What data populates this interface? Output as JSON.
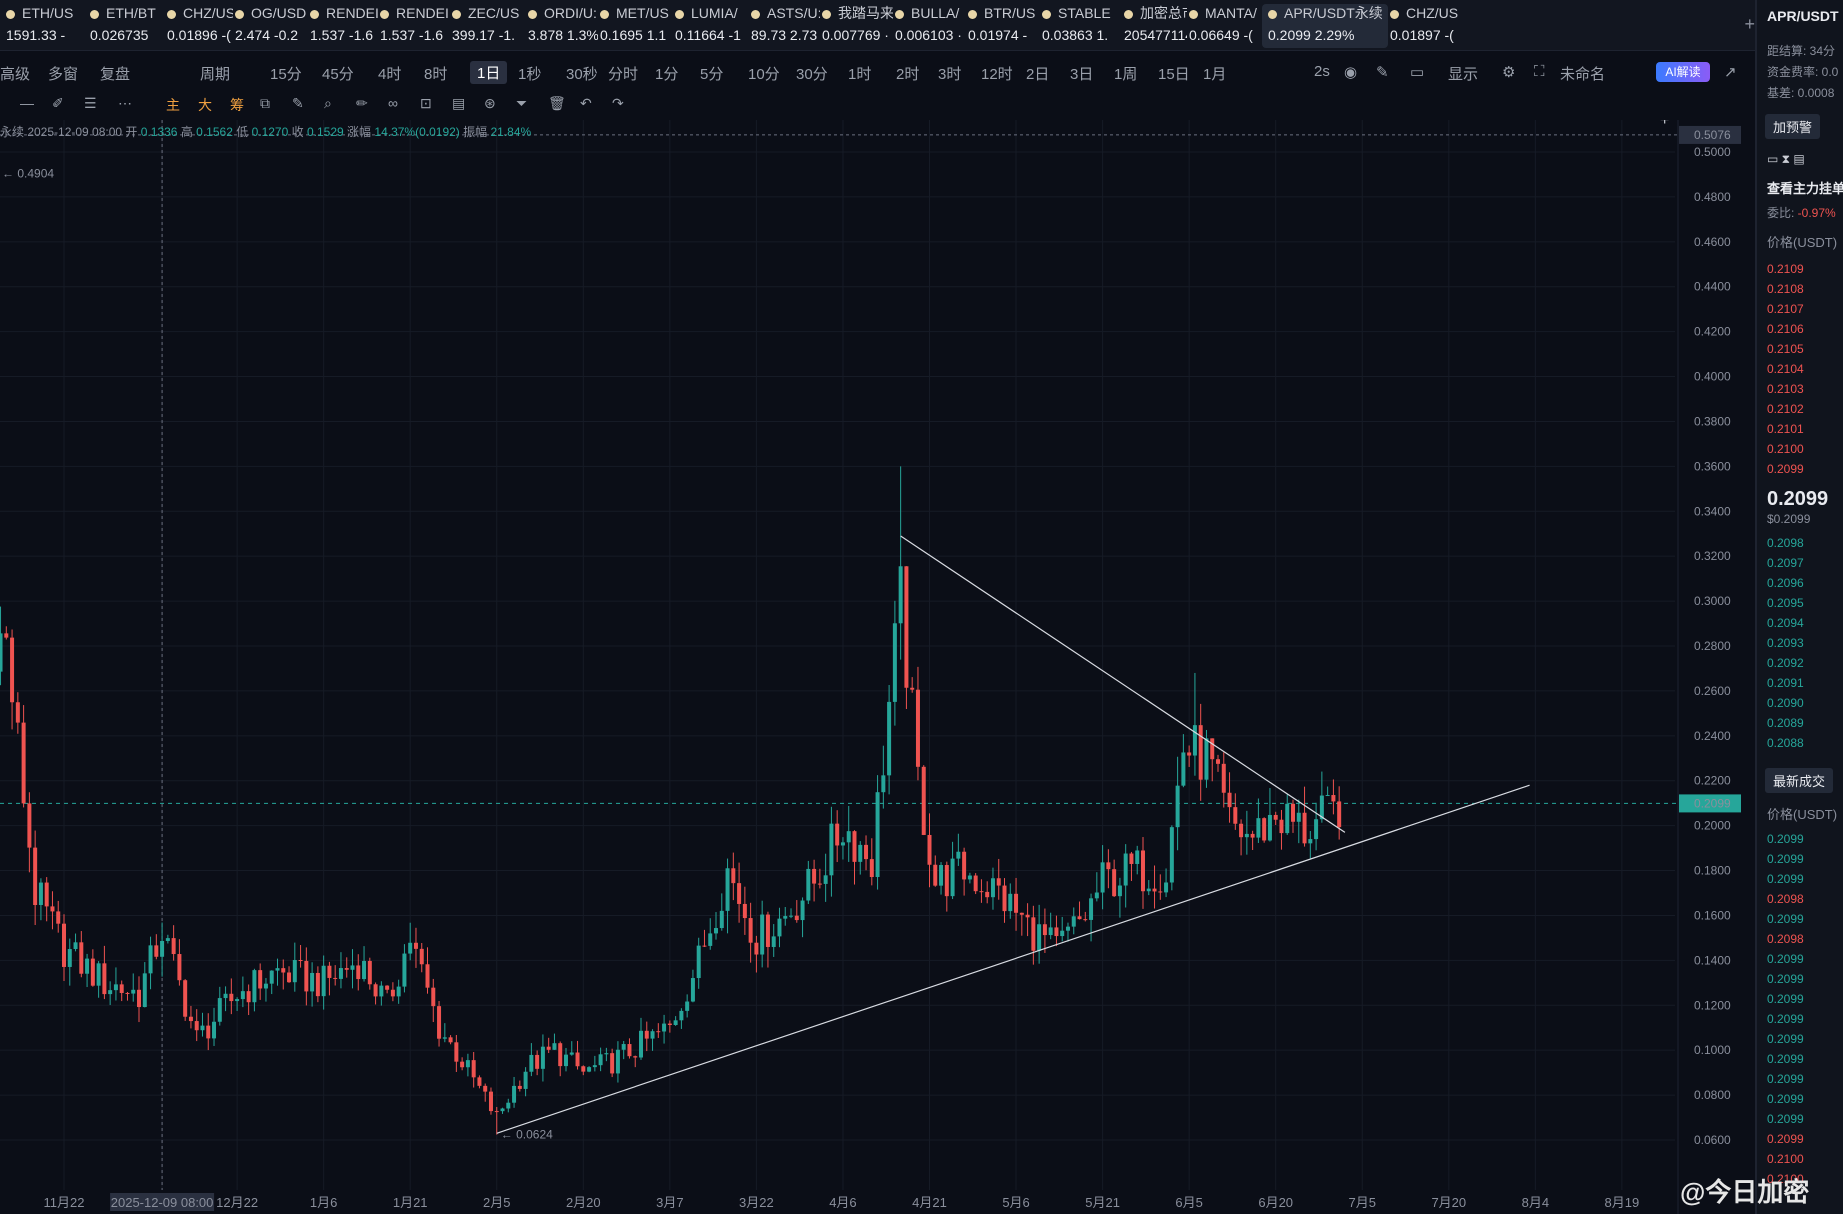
{
  "tickers": [
    {
      "sym": "ETH/US",
      "val": "1591.33 -",
      "dir": "up"
    },
    {
      "sym": "ETH/BT",
      "val": "0.026735",
      "dir": "dn"
    },
    {
      "sym": "CHZ/US",
      "val": "0.01896 -(",
      "dir": "neutral"
    },
    {
      "sym": "OG/USD",
      "val": "2.474 -0.2",
      "dir": "neutral"
    },
    {
      "sym": "RENDEI",
      "val": "1.537 -1.6",
      "dir": "up"
    },
    {
      "sym": "RENDEI",
      "val": "1.537 -1.6",
      "dir": "neutral"
    },
    {
      "sym": "ZEC/US",
      "val": "399.17 -1.",
      "dir": "neutral"
    },
    {
      "sym": "ORDI/U:",
      "val": "3.878 1.3%",
      "dir": "neutral"
    },
    {
      "sym": "MET/US",
      "val": "0.1695 1.1",
      "dir": "up"
    },
    {
      "sym": "LUMIA/",
      "val": "0.11664 -1",
      "dir": "neutral"
    },
    {
      "sym": "ASTS/U:",
      "val": "89.73 2.73",
      "dir": "neutral"
    },
    {
      "sym": "我踏马来",
      "val": "0.007769 ·",
      "dir": "neutral"
    },
    {
      "sym": "BULLA/",
      "val": "0.006103 ·",
      "dir": "neutral"
    },
    {
      "sym": "BTR/US",
      "val": "0.01974 -",
      "dir": "dn"
    },
    {
      "sym": "STABLE",
      "val": "0.03863 1.",
      "dir": "neutral"
    },
    {
      "sym": "加密总市...",
      "val": "205477114",
      "dir": "up"
    },
    {
      "sym": "MANTA/",
      "val": "0.06649 -(",
      "dir": "dn"
    },
    {
      "sym": "APR/USDT永续",
      "val": "0.2099  2.29%",
      "dir": "neutral",
      "active": true
    },
    {
      "sym": "CHZ/US",
      "val": "0.01897 -(",
      "dir": "neutral"
    }
  ],
  "toolbar": {
    "items": [
      "高级",
      "多窗",
      "复盘",
      "周期",
      "15分",
      "45分",
      "4时",
      "8时",
      "1日",
      "1秒",
      "30秒",
      "分时",
      "1分",
      "5分",
      "10分",
      "30分",
      "1时",
      "2时",
      "3时",
      "12时",
      "2日",
      "3日",
      "1周",
      "15日",
      "1月"
    ],
    "selected": "1日",
    "right": [
      "2s",
      "显示",
      "未命名"
    ],
    "ai": "AI解读"
  },
  "toolbar2": [
    "主",
    "大",
    "筹"
  ],
  "info": {
    "prefix": "永续  2025-12-09 08:00  开",
    "open": "0.1336",
    "high_l": "高",
    "high": "0.1562",
    "low_l": "低",
    "low": "0.1270",
    "close_l": "收",
    "close": "0.1529",
    "chg_l": "涨幅",
    "chg": "14.37%(0.0192)",
    "amp_l": "振幅",
    "amp": "21.84%"
  },
  "chart_data": {
    "type": "candlestick",
    "ylim": [
      0.05,
      0.53
    ],
    "y_ticks": [
      0.06,
      0.08,
      0.1,
      0.12,
      0.14,
      0.16,
      0.18,
      0.2,
      0.22,
      0.24,
      0.26,
      0.28,
      0.3,
      0.32,
      0.34,
      0.36,
      0.38,
      0.4,
      0.42,
      0.44,
      0.46,
      0.48,
      0.5
    ],
    "x_ticks": [
      "11月22",
      "2025-12-09 08:00",
      "12月22",
      "1月6",
      "1月21",
      "2月5",
      "2月20",
      "3月7",
      "3月22",
      "4月6",
      "4月21",
      "5月6",
      "5月21",
      "6月5",
      "6月20",
      "7月5",
      "7月20",
      "8月4",
      "8月19"
    ],
    "crosshair_price": "0.5076",
    "last_price": "0.2099",
    "annotations": {
      "high_left": "0.4904",
      "low": "0.0624"
    },
    "trendlines": [
      {
        "name": "upper",
        "from": [
          "4月16",
          0.329
        ],
        "to": [
          "7月2",
          0.197
        ]
      },
      {
        "name": "lower",
        "from": [
          "2月5",
          0.063
        ],
        "to": [
          "8月3",
          0.218
        ]
      }
    ],
    "anchors": [
      [
        "11月8",
        0.29
      ],
      [
        "11月12",
        0.28
      ],
      [
        "11月17",
        0.17
      ],
      [
        "11月22",
        0.145
      ],
      [
        "11月29",
        0.13
      ],
      [
        "12月5",
        0.125
      ],
      [
        "12月9",
        0.153
      ],
      [
        "12月15",
        0.105
      ],
      [
        "12月22",
        0.125
      ],
      [
        "12月29",
        0.135
      ],
      [
        "1月6",
        0.13
      ],
      [
        "1月12",
        0.14
      ],
      [
        "1月17",
        0.12
      ],
      [
        "1月21",
        0.15
      ],
      [
        "1月26",
        0.11
      ],
      [
        "1月30",
        0.095
      ],
      [
        "2月5",
        0.07
      ],
      [
        "2月10",
        0.092
      ],
      [
        "2月15",
        0.1
      ],
      [
        "2月20",
        0.09
      ],
      [
        "2月25",
        0.095
      ],
      [
        "3月7",
        0.11
      ],
      [
        "3月12",
        0.14
      ],
      [
        "3月17",
        0.18
      ],
      [
        "3月22",
        0.15
      ],
      [
        "3月27",
        0.16
      ],
      [
        "4月1",
        0.175
      ],
      [
        "4月6",
        0.2
      ],
      [
        "4月11",
        0.185
      ],
      [
        "4月16",
        0.3
      ],
      [
        "4月19",
        0.22
      ],
      [
        "4月22",
        0.175
      ],
      [
        "4月27",
        0.18
      ],
      [
        "5月3",
        0.17
      ],
      [
        "5月8",
        0.155
      ],
      [
        "5月13",
        0.145
      ],
      [
        "5月18",
        0.16
      ],
      [
        "5月21",
        0.175
      ],
      [
        "5月26",
        0.18
      ],
      [
        "6月1",
        0.18
      ],
      [
        "6月4",
        0.235
      ],
      [
        "6月8",
        0.23
      ],
      [
        "6月12",
        0.2
      ],
      [
        "6月16",
        0.195
      ],
      [
        "6月20",
        0.205
      ],
      [
        "6月25",
        0.198
      ],
      [
        "6月30",
        0.205
      ],
      [
        "7月1",
        0.2099
      ]
    ]
  },
  "rightpanel": {
    "title": "APR/USDT",
    "l1": "距结算: 34分",
    "l2": "资金费率: 0.0",
    "l3": "基差: 0.0008",
    "btn1": "加预警",
    "depth": "查看主力挂单",
    "ratio_l": "委比:",
    "ratio": "-0.97%",
    "price_h": "价格(USDT)",
    "asks": [
      "0.2109",
      "0.2108",
      "0.2107",
      "0.2106",
      "0.2105",
      "0.2104",
      "0.2103",
      "0.2102",
      "0.2101",
      "0.2100",
      "0.2099"
    ],
    "last": "0.2099",
    "last_usd": "$0.2099",
    "bids": [
      "0.2098",
      "0.2097",
      "0.2096",
      "0.2095",
      "0.2094",
      "0.2093",
      "0.2092",
      "0.2091",
      "0.2090",
      "0.2089",
      "0.2088"
    ],
    "trades_btn": "最新成交",
    "trades_h": "价格(USDT)",
    "trades": [
      {
        "p": "0.2099",
        "d": "up"
      },
      {
        "p": "0.2099",
        "d": "up"
      },
      {
        "p": "0.2099",
        "d": "up"
      },
      {
        "p": "0.2098",
        "d": "dn"
      },
      {
        "p": "0.2099",
        "d": "up"
      },
      {
        "p": "0.2098",
        "d": "dn"
      },
      {
        "p": "0.2099",
        "d": "up"
      },
      {
        "p": "0.2099",
        "d": "up"
      },
      {
        "p": "0.2099",
        "d": "up"
      },
      {
        "p": "0.2099",
        "d": "up"
      },
      {
        "p": "0.2099",
        "d": "up"
      },
      {
        "p": "0.2099",
        "d": "up"
      },
      {
        "p": "0.2099",
        "d": "up"
      },
      {
        "p": "0.2099",
        "d": "up"
      },
      {
        "p": "0.2099",
        "d": "up"
      },
      {
        "p": "0.2099",
        "d": "dn"
      },
      {
        "p": "0.2100",
        "d": "dn"
      },
      {
        "p": "0.2100",
        "d": "dn"
      }
    ]
  },
  "watermark": "@今日加密",
  "colors": {
    "up": "#26a69a",
    "down": "#ef5350",
    "bg": "#0b0e17",
    "grid": "#1a1f2b"
  }
}
